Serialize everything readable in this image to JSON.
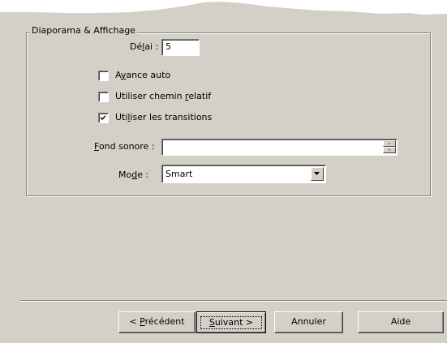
{
  "group": {
    "title": "Diaporama & Affichage"
  },
  "delai": {
    "label_pre": "Dé",
    "label_mnemonic": "l",
    "label_post": "ai :",
    "value": "5"
  },
  "options": {
    "avance_auto": {
      "label_pre": "A",
      "label_mnemonic": "v",
      "label_post": "ance auto",
      "checked": false
    },
    "chemin_relatif": {
      "label_pre": "Utiliser chemin ",
      "label_mnemonic": "r",
      "label_post": "elatif",
      "checked": false
    },
    "transitions": {
      "label_pre": "Uti",
      "label_mnemonic": "l",
      "label_post": "iser les transitions",
      "checked": true
    }
  },
  "fond_sonore": {
    "label_pre": "",
    "label_mnemonic": "F",
    "label_post": "ond sonore :",
    "value": ""
  },
  "mode": {
    "label_pre": "Mo",
    "label_mnemonic": "d",
    "label_post": "e :",
    "selected": "Smart"
  },
  "buttons": {
    "precedent": {
      "pre": "< ",
      "mnemonic": "P",
      "post": "récédent"
    },
    "suivant": {
      "pre": "",
      "mnemonic": "S",
      "post": "uivant >"
    },
    "annuler": "Annuler",
    "aide": "Aide"
  }
}
